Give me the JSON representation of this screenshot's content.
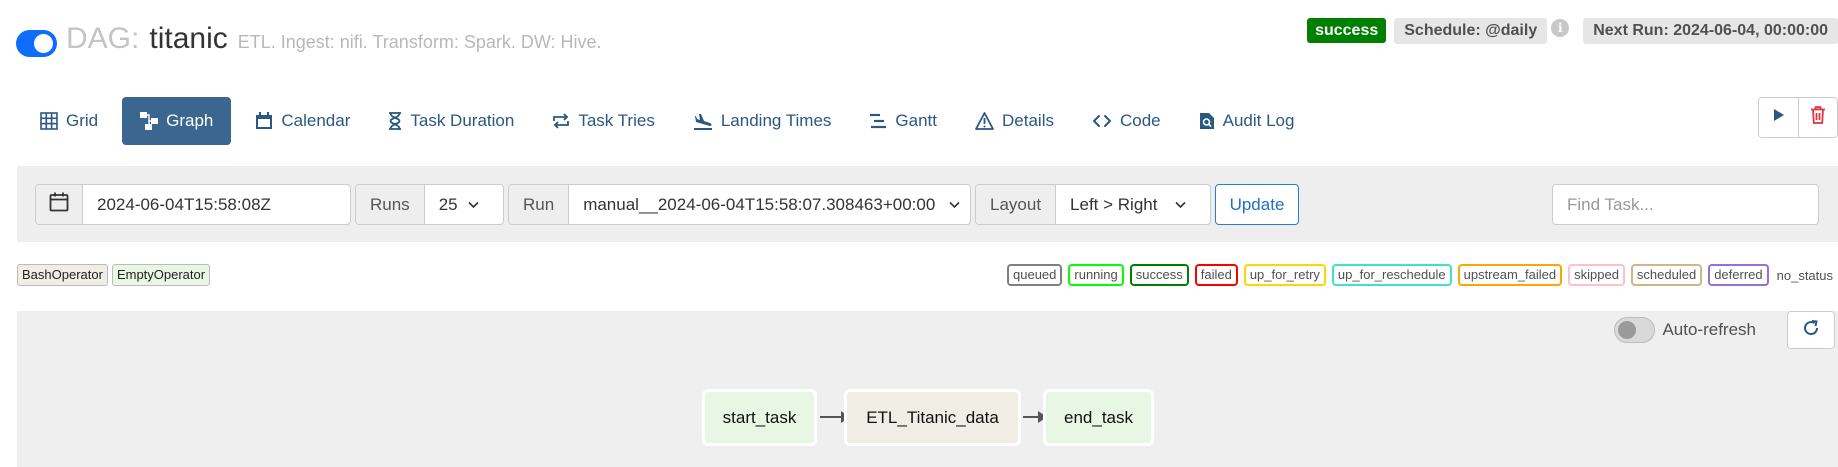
{
  "header": {
    "dag_prefix": "DAG:",
    "dag_name": "titanic",
    "dag_description": "ETL. Ingest: nifi. Transform: Spark. DW: Hive.",
    "status": "success",
    "schedule": "Schedule: @daily",
    "info_glyph": "i",
    "next_run": "Next Run: 2024-06-04, 00:00:00"
  },
  "nav": {
    "tabs": [
      {
        "label": "Grid",
        "icon": "grid-icon"
      },
      {
        "label": "Graph",
        "icon": "graph-icon",
        "active": true
      },
      {
        "label": "Calendar",
        "icon": "calendar-icon"
      },
      {
        "label": "Task Duration",
        "icon": "hourglass-icon"
      },
      {
        "label": "Task Tries",
        "icon": "retry-icon"
      },
      {
        "label": "Landing Times",
        "icon": "plane-landing-icon"
      },
      {
        "label": "Gantt",
        "icon": "gantt-icon"
      },
      {
        "label": "Details",
        "icon": "warning-triangle-icon"
      },
      {
        "label": "Code",
        "icon": "code-icon"
      },
      {
        "label": "Audit Log",
        "icon": "file-search-icon"
      }
    ]
  },
  "filters": {
    "base_date": "2024-06-04T15:58:08Z",
    "runs_label": "Runs",
    "runs_value": "25",
    "run_label": "Run",
    "run_value": "manual__2024-06-04T15:58:07.308463+00:00",
    "layout_label": "Layout",
    "layout_value": "Left > Right",
    "update_label": "Update",
    "find_task_placeholder": "Find Task..."
  },
  "legend": {
    "operators": [
      {
        "label": "BashOperator",
        "color": "#f0ede4"
      },
      {
        "label": "EmptyOperator",
        "color": "#e8f7e4"
      }
    ],
    "states": [
      {
        "label": "queued",
        "color": "#808080"
      },
      {
        "label": "running",
        "color": "#00ff00"
      },
      {
        "label": "success",
        "color": "#008000"
      },
      {
        "label": "failed",
        "color": "#ff0000"
      },
      {
        "label": "up_for_retry",
        "color": "#ffd700"
      },
      {
        "label": "up_for_reschedule",
        "color": "#40e0d0"
      },
      {
        "label": "upstream_failed",
        "color": "#ffa500"
      },
      {
        "label": "skipped",
        "color": "#ffc0cb"
      },
      {
        "label": "scheduled",
        "color": "#d2b48c"
      },
      {
        "label": "deferred",
        "color": "#9370db"
      }
    ],
    "no_status": "no_status"
  },
  "graph": {
    "autorefresh_label": "Auto-refresh",
    "nodes": [
      {
        "label": "start_task",
        "color": "#e8f7e4"
      },
      {
        "label": "ETL_Titanic_data",
        "color": "#f0ede4"
      },
      {
        "label": "end_task",
        "color": "#e8f7e4"
      }
    ]
  },
  "colors": {
    "accent": "#3b6690",
    "link": "#2a5881",
    "success": "#008000",
    "delete": "#dc3545"
  }
}
